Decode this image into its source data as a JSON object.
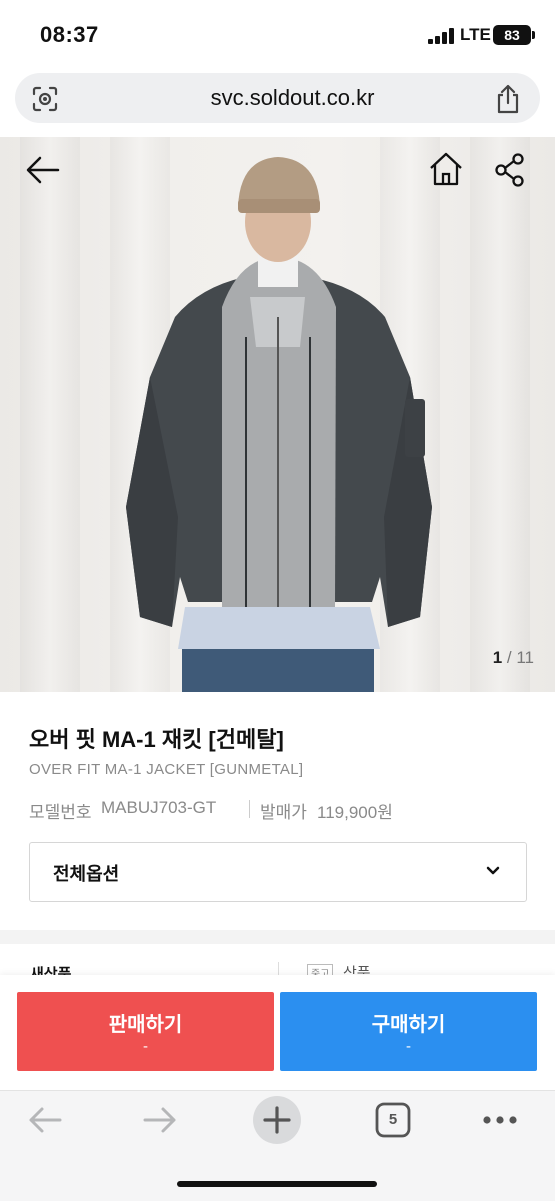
{
  "status_bar": {
    "time": "08:37",
    "network": "LTE",
    "battery": "83"
  },
  "browser": {
    "url": "svc.soldout.co.kr",
    "tabs_count": "5"
  },
  "gallery": {
    "current": "1",
    "total": "/ 11"
  },
  "product": {
    "title": "오버 핏 MA-1 재킷 [건메탈]",
    "subtitle": "OVER FIT MA-1 JACKET [GUNMETAL]",
    "model_label": "모델번호",
    "model_value": "MABUJ703-GT",
    "price_label": "발매가",
    "price_value": "119,900원"
  },
  "options": {
    "label": "전체옵션"
  },
  "peek": {
    "left": "새상품",
    "right_tag": "중고",
    "right": "상품"
  },
  "actions": {
    "sell_label": "판매하기",
    "sell_value": "-",
    "buy_label": "구매하기",
    "buy_value": "-"
  },
  "colors": {
    "sell": "#ef5050",
    "buy": "#2b8ff0"
  },
  "icons": [
    "back-icon",
    "home-icon",
    "share-icon",
    "lens-icon",
    "chevron-down-icon",
    "plus-icon",
    "more-icon"
  ]
}
